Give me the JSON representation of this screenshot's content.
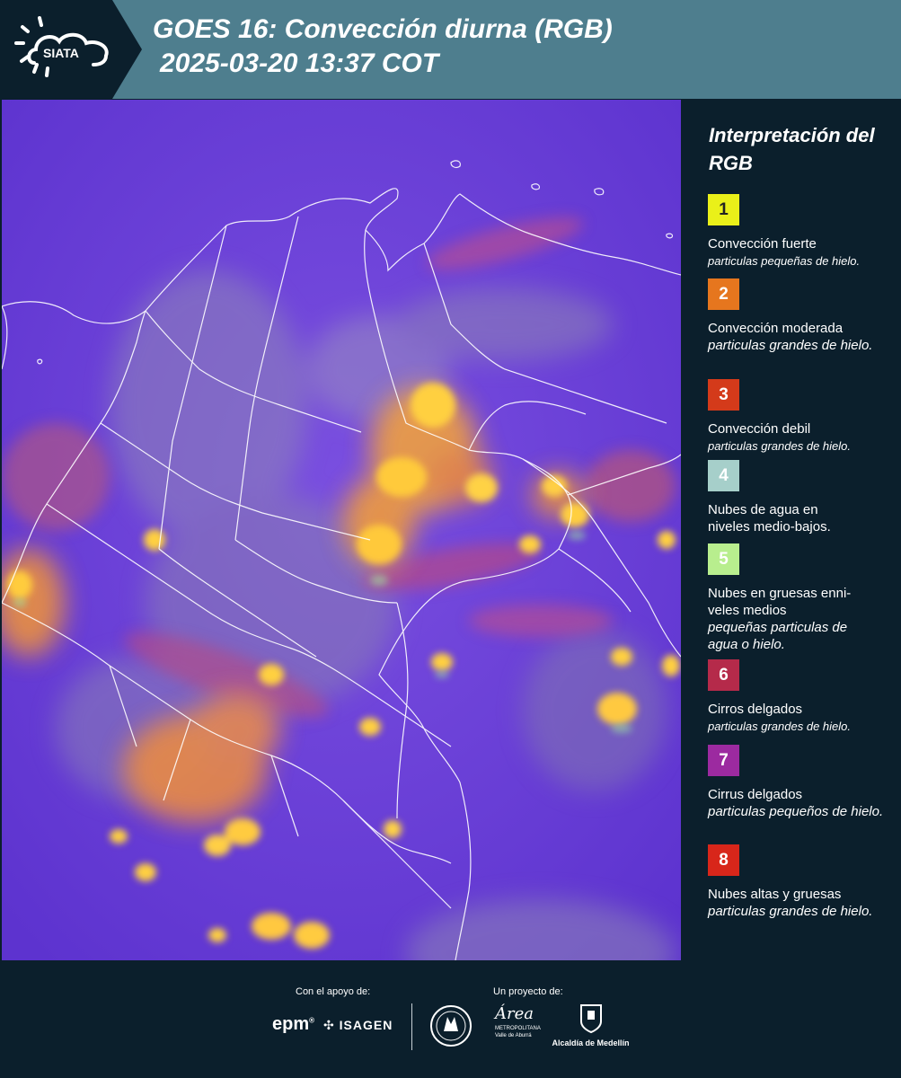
{
  "header": {
    "logo_text": "SIATA",
    "title_line1": "GOES 16: Convección diurna (RGB)",
    "title_line2": "2025-03-20 13:37 COT"
  },
  "legend": {
    "title": "Interpretación del RGB",
    "items": [
      {
        "number": "1",
        "color": "#eaf019",
        "number_color": "#222222",
        "label": "Convección fuerte",
        "desc": "particulas pequeñas de hielo."
      },
      {
        "number": "2",
        "color": "#e6761e",
        "number_color": "#ffffff",
        "label": "Convección moderada",
        "desc": "particulas grandes de hielo."
      },
      {
        "number": "3",
        "color": "#d43a1a",
        "number_color": "#ffffff",
        "label": "Convección debil",
        "desc": "particulas grandes de hielo."
      },
      {
        "number": "4",
        "color": "#a6cfca",
        "number_color": "#ffffff",
        "label": "Nubes de agua en niveles medio-bajos.",
        "desc": ""
      },
      {
        "number": "5",
        "color": "#b8ee8e",
        "number_color": "#ffffff",
        "label": "Nubes en gruesas enni-veles medios",
        "desc": "pequeñas particulas de agua o hielo."
      },
      {
        "number": "6",
        "color": "#b52a4a",
        "number_color": "#ffffff",
        "label": "Cirros delgados",
        "desc": "particulas grandes de hielo."
      },
      {
        "number": "7",
        "color": "#9c2aa0",
        "number_color": "#ffffff",
        "label": "Cirrus delgados",
        "desc": "particulas pequeños de hielo."
      },
      {
        "number": "8",
        "color": "#d8261a",
        "number_color": "#ffffff",
        "label": "Nubes altas y gruesas",
        "desc": "particulas grandes de hielo."
      }
    ]
  },
  "footer": {
    "support_label": "Con el apoyo de:",
    "project_label": "Un proyecto de:",
    "epm": "epm",
    "isagen": "ISAGEN",
    "area_top": "Área",
    "area_sub1": "METROPOLITANA",
    "area_sub2": "Valle de Aburrá",
    "alcaldia": "Alcaldía de Medellín"
  },
  "colors": {
    "header_bg": "#4e7e8e",
    "panel_bg": "#0b1f2c",
    "map_base": "#6b3fd8"
  }
}
